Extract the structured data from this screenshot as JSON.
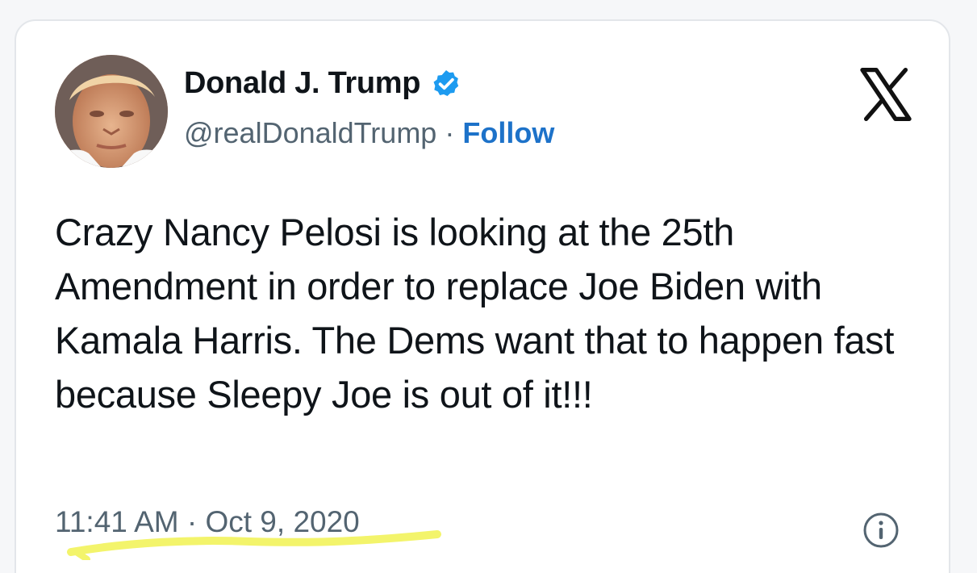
{
  "author": {
    "display_name": "Donald J. Trump",
    "handle": "@realDonaldTrump",
    "separator": "·",
    "follow_label": "Follow",
    "verified": true
  },
  "brand": {
    "logo_icon": "x-logo-icon"
  },
  "tweet": {
    "text": "Crazy Nancy Pelosi is looking at the 25th Amendment in order to replace Joe Biden with Kamala Harris. The Dems want that to happen fast because Sleepy Joe is out of it!!!",
    "timestamp": "11:41 AM · Oct 9, 2020"
  },
  "icons": {
    "verified": "verified-badge-icon",
    "info": "info-icon"
  },
  "colors": {
    "accent": "#1d72c9",
    "verified_badge": "#1d9bf0",
    "highlight": "#f3f46b",
    "text_primary": "#0f1419",
    "text_secondary": "#536471"
  }
}
